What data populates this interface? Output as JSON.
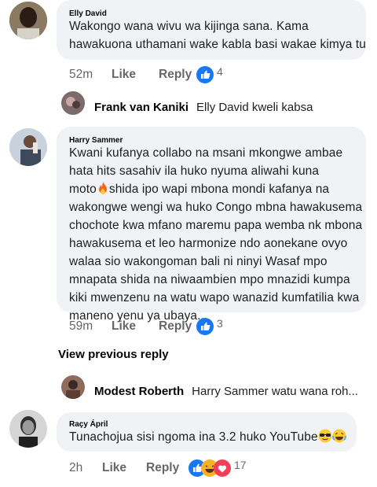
{
  "comments": [
    {
      "author": "Elly David",
      "lines": [
        "Wakongo wana wivu wa kijinga sana. Kama",
        "hawakuona uthamani wake kabla basi wakae kimya tu"
      ],
      "time": "52m",
      "like_label": "Like",
      "reply_label": "Reply",
      "reaction_count": "4"
    },
    {
      "author": "Harry Sammer",
      "lines": [
        "Kwani kufanya collabo na msani mkongwe ambae",
        "hata hits sasahiv ila huko nyuma aliwahi kuna",
        "moto",
        "shida ipo wapi mbona mondi kafanya na",
        "wakongwe wengi wa huko Congo mbna hawakusema",
        "chochote kwa mfano maremu papa wemba nk mbona",
        "hawakusema et leo harmonize ndo aonekane ovyo",
        "walaa sio wakongoman bali ni ninyi Wasaf mpo",
        "mnapata shida na niwaambien mpo mnazidi kumpa",
        "kiki mwenzenu na watu wapo wanazid kumfatilia kwa",
        "maneno yenu ya ubaya..."
      ],
      "time": "59m",
      "like_label": "Like",
      "reply_label": "Reply",
      "reaction_count": "3"
    },
    {
      "author": "Raçy Ápril",
      "text": "Tunachojua sisi ngoma ina 3.2 huko YouTube",
      "time": "2h",
      "like_label": "Like",
      "reply_label": "Reply",
      "reaction_count": "17"
    }
  ],
  "replies": [
    {
      "name": "Frank van Kaniki",
      "text": "Elly David kweli kabsa"
    },
    {
      "name": "Modest Roberth",
      "text": "Harry Sammer watu wana roh..."
    }
  ],
  "view_previous_label": "View previous reply",
  "icons": {
    "like_reaction": "thumbs-up-icon",
    "haha_reaction": "laughing-face-icon",
    "love_reaction": "heart-icon",
    "fire": "fire-emoji-icon",
    "sunglasses": "sunglasses-emoji-icon",
    "crying_laughing": "crying-laughing-emoji-icon"
  },
  "colors": {
    "like_blue": "#1877f2",
    "bubble": "#f0f2f5",
    "meta_gray": "#65676b",
    "heart_red": "#f33e58",
    "haha_yellow": "#f7b125"
  }
}
